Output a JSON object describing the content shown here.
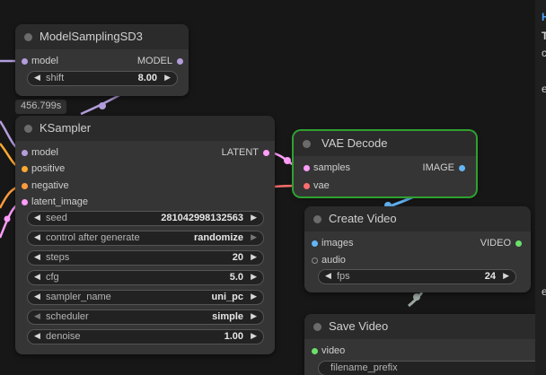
{
  "colors": {
    "model": "#b39ddb",
    "positive": "#ffa931",
    "negative": "#ff9b3d",
    "latent": "#ff9cf9",
    "vae": "#ff6e6e",
    "image": "#64b5f6",
    "audio": "#7a7a7a",
    "video": "#6be06b",
    "selected_border": "#2fa12f"
  },
  "timing_badge": "456.799s",
  "nodes": {
    "model_sampling": {
      "title": "ModelSamplingSD3",
      "input_model": "model",
      "output_model": "MODEL",
      "shift_label": "shift",
      "shift_value": "8.00"
    },
    "ksampler": {
      "title": "KSampler",
      "inputs": [
        "model",
        "positive",
        "negative",
        "latent_image"
      ],
      "output": "LATENT",
      "widgets": [
        {
          "label": "seed",
          "value": "281042998132563"
        },
        {
          "label": "control after generate",
          "value": "randomize"
        },
        {
          "label": "steps",
          "value": "20"
        },
        {
          "label": "cfg",
          "value": "5.0"
        },
        {
          "label": "sampler_name",
          "value": "uni_pc"
        },
        {
          "label": "scheduler",
          "value": "simple"
        },
        {
          "label": "denoise",
          "value": "1.00"
        }
      ]
    },
    "vae_decode": {
      "title": "VAE Decode",
      "input_samples": "samples",
      "input_vae": "vae",
      "output": "IMAGE"
    },
    "create_video": {
      "title": "Create Video",
      "input_images": "images",
      "input_audio": "audio",
      "output": "VIDEO",
      "fps_label": "fps",
      "fps_value": "24"
    },
    "save_video": {
      "title": "Save Video",
      "input_video": "video",
      "filename_label": "filename_prefix"
    }
  },
  "right_panel_chars": [
    "H",
    "T",
    "c",
    "e",
    "e"
  ]
}
